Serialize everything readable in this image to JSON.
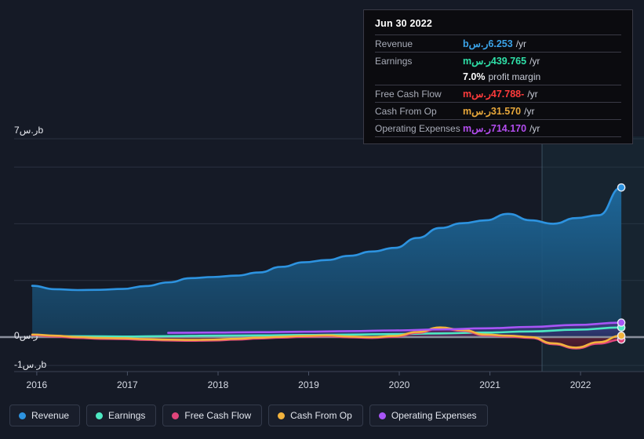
{
  "theme": {
    "background": "#151A26",
    "plot_background": "#151A26",
    "gridline": "#2B3140",
    "axis_text": "#E8EAF0"
  },
  "axes": {
    "y_labels": [
      {
        "text": "7ر.سb",
        "value": 7000
      },
      {
        "text": "0ر.س",
        "value": 0
      },
      {
        "text": "-1ر.سb",
        "value": -1000
      }
    ],
    "x_labels": [
      "2016",
      "2017",
      "2018",
      "2019",
      "2020",
      "2021",
      "2022"
    ]
  },
  "tooltip": {
    "date": "Jun 30 2022",
    "rows": [
      {
        "label": "Revenue",
        "value": "6.253ر.سb",
        "unit": "/yr",
        "color": "#3BA3E8"
      },
      {
        "label": "Earnings",
        "value": "439.765ر.سm",
        "unit": "/yr",
        "color": "#2FE0A8"
      },
      {
        "label": "",
        "value": "7.0%",
        "unit": "profit margin",
        "color": "#FFFFFF"
      },
      {
        "label": "Free Cash Flow",
        "value": "-47.788ر.سm",
        "unit": "/yr",
        "color": "#FF3B3B"
      },
      {
        "label": "Cash From Op",
        "value": "31.570ر.سm",
        "unit": "/yr",
        "color": "#E8A83B"
      },
      {
        "label": "Operating Expenses",
        "value": "714.170ر.سm",
        "unit": "/yr",
        "color": "#B44DF0"
      }
    ]
  },
  "legend": [
    {
      "label": "Revenue",
      "color": "#2D93E0"
    },
    {
      "label": "Earnings",
      "color": "#4DE8C2"
    },
    {
      "label": "Free Cash Flow",
      "color": "#E0457B"
    },
    {
      "label": "Cash From Op",
      "color": "#F2B33D"
    },
    {
      "label": "Operating Expenses",
      "color": "#A855F7"
    }
  ],
  "chart_data": {
    "type": "area",
    "title": "",
    "xlabel": "",
    "ylabel": "",
    "xlim": [
      2015.75,
      2022.7
    ],
    "ylim": [
      -1000,
      7000
    ],
    "y_unit": "ر.س millions",
    "grid": true,
    "legend_position": "bottom",
    "forecast_boundary_x": 2021.45,
    "series": [
      {
        "name": "Revenue",
        "color": "#2D93E0",
        "filled": true,
        "x": [
          2015.95,
          2016.2,
          2016.45,
          2016.7,
          2016.95,
          2017.2,
          2017.45,
          2017.7,
          2017.95,
          2018.2,
          2018.45,
          2018.7,
          2018.95,
          2019.2,
          2019.45,
          2019.7,
          2019.95,
          2020.2,
          2020.45,
          2020.7,
          2020.95,
          2021.2,
          2021.45,
          2021.7,
          2021.95,
          2022.2,
          2022.45
        ],
        "values": [
          1810,
          1690,
          1660,
          1670,
          1700,
          1800,
          1930,
          2080,
          2120,
          2170,
          2280,
          2480,
          2640,
          2720,
          2870,
          3020,
          3150,
          3500,
          3850,
          4020,
          4120,
          4350,
          4120,
          4000,
          4200,
          4300,
          5280
        ]
      },
      {
        "name": "Earnings",
        "color": "#4DE8C2",
        "filled": false,
        "x": [
          2015.95,
          2016.45,
          2016.95,
          2017.45,
          2017.95,
          2018.45,
          2018.95,
          2019.45,
          2019.95,
          2020.45,
          2020.95,
          2021.45,
          2021.95,
          2022.45
        ],
        "values": [
          45,
          30,
          20,
          35,
          50,
          60,
          75,
          90,
          105,
          130,
          160,
          200,
          260,
          340
        ]
      },
      {
        "name": "Free Cash Flow",
        "color": "#E0457B",
        "filled": true,
        "x": [
          2015.95,
          2016.2,
          2016.45,
          2016.7,
          2016.95,
          2017.2,
          2017.45,
          2017.7,
          2017.95,
          2018.2,
          2018.45,
          2018.7,
          2018.95,
          2019.2,
          2019.45,
          2019.7,
          2019.95,
          2020.2,
          2020.45,
          2020.7,
          2020.95,
          2021.2,
          2021.45,
          2021.7,
          2021.95,
          2022.2,
          2022.45
        ],
        "values": [
          60,
          20,
          -30,
          -60,
          -70,
          -100,
          -120,
          -130,
          -120,
          -90,
          -50,
          -20,
          10,
          30,
          -10,
          -30,
          10,
          150,
          310,
          220,
          60,
          20,
          -30,
          -250,
          -400,
          -230,
          -90
        ]
      },
      {
        "name": "Cash From Op",
        "color": "#F2B33D",
        "filled": false,
        "x": [
          2015.95,
          2016.2,
          2016.45,
          2016.7,
          2016.95,
          2017.2,
          2017.45,
          2017.7,
          2017.95,
          2018.2,
          2018.45,
          2018.7,
          2018.95,
          2019.2,
          2019.45,
          2019.7,
          2019.95,
          2020.2,
          2020.45,
          2020.7,
          2020.95,
          2021.2,
          2021.45,
          2021.7,
          2021.95,
          2022.2,
          2022.45
        ],
        "values": [
          90,
          50,
          0,
          -30,
          -40,
          -70,
          -90,
          -100,
          -90,
          -60,
          -20,
          10,
          40,
          60,
          20,
          0,
          40,
          180,
          340,
          250,
          90,
          50,
          0,
          -220,
          -370,
          -180,
          50
        ]
      },
      {
        "name": "Operating Expenses",
        "color": "#A855F7",
        "filled": true,
        "x": [
          2017.45,
          2017.95,
          2018.45,
          2018.95,
          2019.45,
          2019.95,
          2020.45,
          2020.95,
          2021.45,
          2021.95,
          2022.45
        ],
        "values": [
          150,
          160,
          175,
          190,
          210,
          235,
          270,
          310,
          360,
          430,
          510
        ]
      }
    ]
  }
}
